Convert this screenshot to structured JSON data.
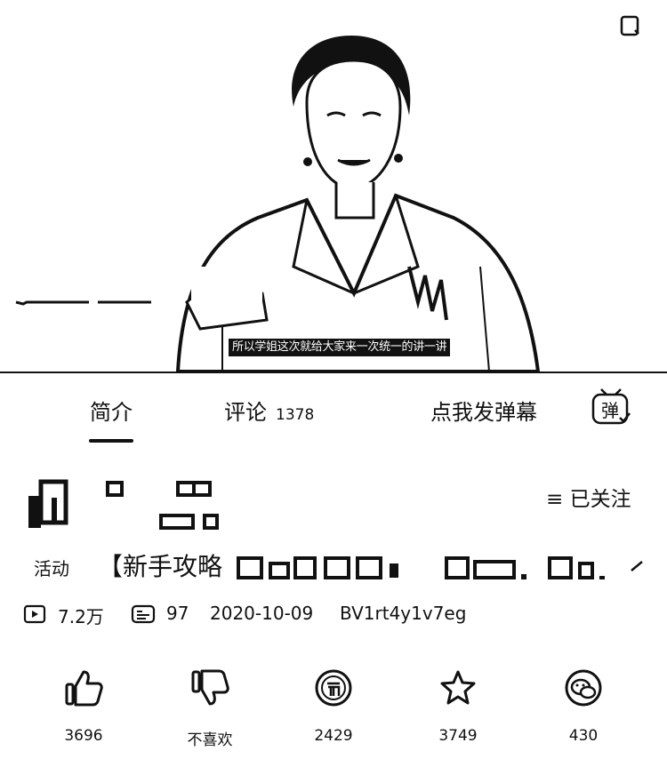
{
  "video": {
    "subtitle": "所以学姐这次就给大家来一次统一的讲一讲"
  },
  "tabs": {
    "intro": "简介",
    "comments": "评论",
    "comments_count": "1378",
    "danmaku_placeholder": "点我发弹幕",
    "danmaku_toggle_label": "弹"
  },
  "author": {
    "follow_label": "≡ 已关注"
  },
  "title": {
    "event_tag": "活动",
    "text": "【新手攻略"
  },
  "stats": {
    "views": "7.2万",
    "danmaku": "97",
    "date": "2020-10-09",
    "bvid": "BV1rt4y1v7eg"
  },
  "actions": {
    "like": "3696",
    "dislike": "不喜欢",
    "coin": "2429",
    "favorite": "3749",
    "share": "430"
  },
  "icons": [
    "fullscreen-icon",
    "danmaku-toggle-icon",
    "play-count-icon",
    "danmaku-count-icon",
    "thumbs-up-icon",
    "thumbs-down-icon",
    "coin-icon",
    "star-icon",
    "share-icon"
  ]
}
